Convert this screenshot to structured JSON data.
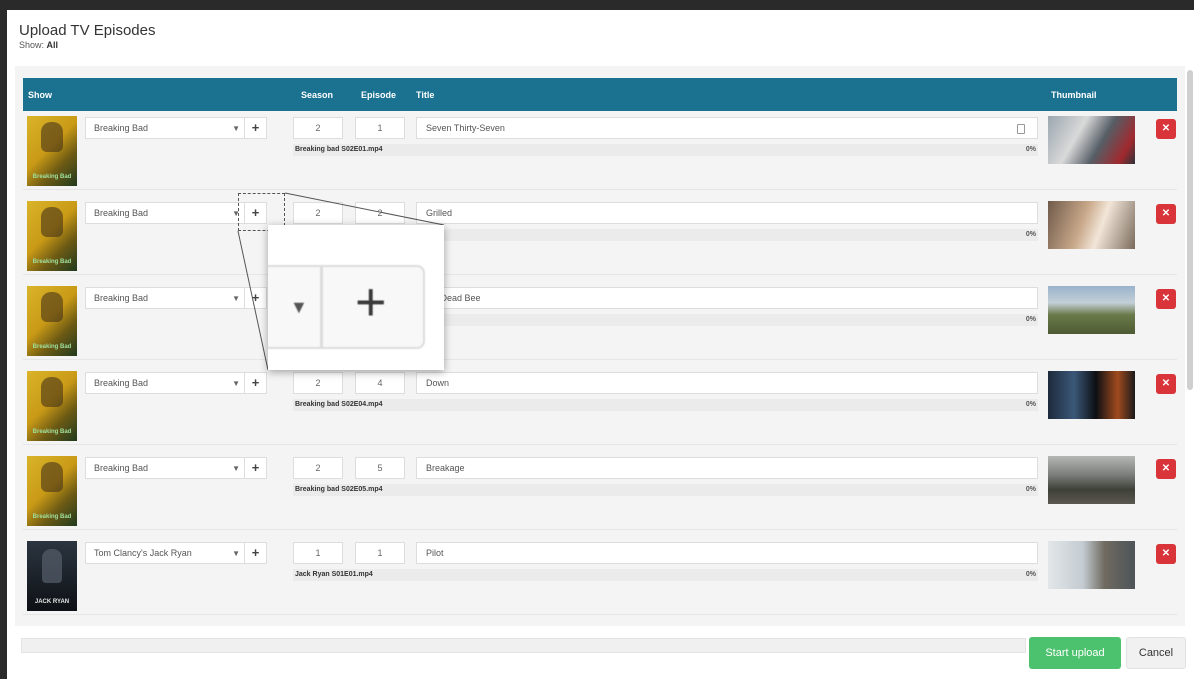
{
  "header": {
    "title": "Upload TV Episodes",
    "subtitle_prefix": "Show:",
    "subtitle_value": "All"
  },
  "columns": {
    "show": "Show",
    "season": "Season",
    "episode": "Episode",
    "title": "Title",
    "thumbnail": "Thumbnail"
  },
  "rows": [
    {
      "poster_label": "Breaking Bad",
      "show": "Breaking Bad",
      "season": "2",
      "episode": "1",
      "title": "Seven Thirty-Seven",
      "filename": "Breaking bad S02E01.mp4",
      "progress": "0%"
    },
    {
      "poster_label": "Breaking Bad",
      "show": "Breaking Bad",
      "season": "2",
      "episode": "2",
      "title": "Grilled",
      "filename": "",
      "progress": "0%"
    },
    {
      "poster_label": "Breaking Bad",
      "show": "Breaking Bad",
      "season": "",
      "episode": "",
      "title": "y a Dead Bee",
      "filename": "",
      "progress": "0%"
    },
    {
      "poster_label": "Breaking Bad",
      "show": "Breaking Bad",
      "season": "2",
      "episode": "4",
      "title": "Down",
      "filename": "Breaking bad S02E04.mp4",
      "progress": "0%"
    },
    {
      "poster_label": "Breaking Bad",
      "show": "Breaking Bad",
      "season": "2",
      "episode": "5",
      "title": "Breakage",
      "filename": "Breaking bad S02E05.mp4",
      "progress": "0%"
    },
    {
      "poster_label": "JACK RYAN",
      "show": "Tom Clancy's Jack Ryan",
      "season": "1",
      "episode": "1",
      "title": "Pilot",
      "filename": "Jack Ryan S01E01.mp4",
      "progress": "0%"
    }
  ],
  "icons": {
    "caret": "▼",
    "plus": "+",
    "remove": "✕"
  },
  "footer": {
    "start_label": "Start upload",
    "cancel_label": "Cancel"
  },
  "colors": {
    "header_bg": "#1a7190",
    "remove_bg": "#d9343a",
    "start_bg": "#4cc26e"
  }
}
